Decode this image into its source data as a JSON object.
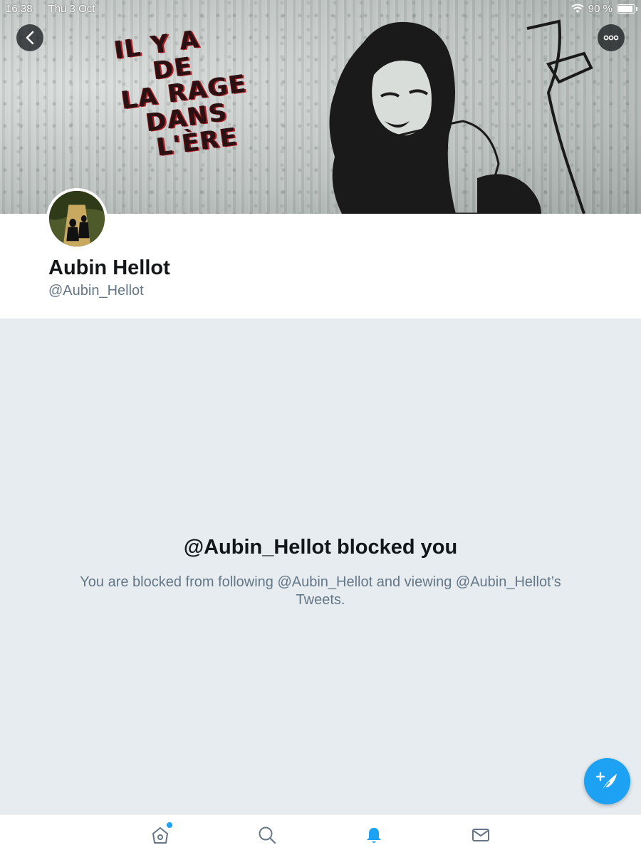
{
  "status_bar": {
    "time": "16:38",
    "date": "Thu 3 Oct",
    "battery": "90 %",
    "battery_level": 0.9
  },
  "banner": {
    "graffiti_lines": [
      "IL Y A",
      "DE",
      "LA RAGE",
      "DANS",
      "L'ÈRE"
    ]
  },
  "profile": {
    "display_name": "Aubin Hellot",
    "handle": "@Aubin_Hellot"
  },
  "blocked": {
    "title": "@Aubin_Hellot blocked you",
    "description": "You are blocked from following @Aubin_Hellot and viewing @Aubin_Hellot’s Tweets."
  },
  "tabs": [
    {
      "icon": "home-icon",
      "active": false,
      "has_dot": true
    },
    {
      "icon": "search-icon",
      "active": false
    },
    {
      "icon": "bell-icon",
      "active": true
    },
    {
      "icon": "mail-icon",
      "active": false
    }
  ],
  "colors": {
    "accent": "#1da1f2",
    "text_primary": "#14171a",
    "text_secondary": "#657786",
    "background": "#e6ecf0"
  }
}
